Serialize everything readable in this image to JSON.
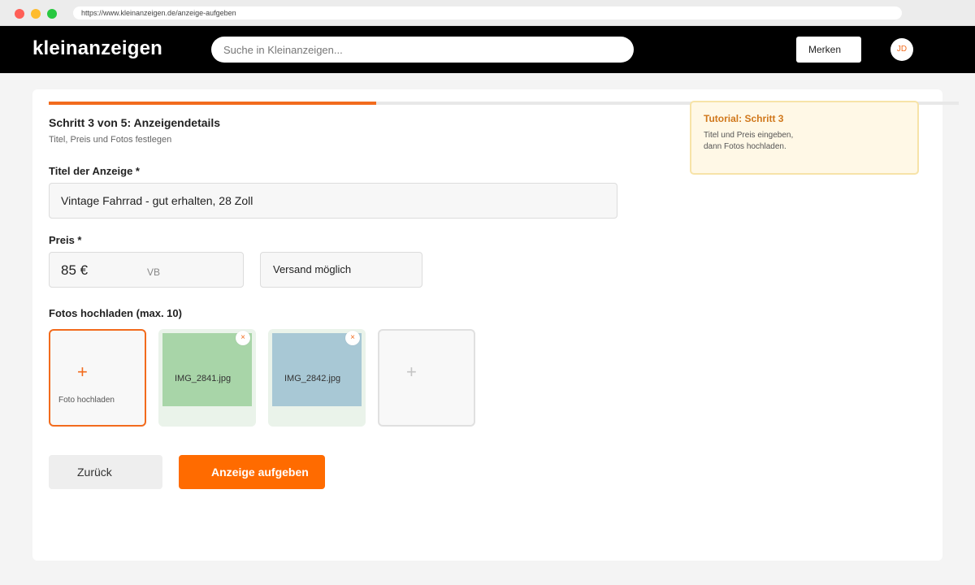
{
  "browser": {
    "url": "https://www.kleinanzeigen.de/anzeige-aufgeben"
  },
  "header": {
    "logo": "kleinanzeigen",
    "search_placeholder": "Suche in Kleinanzeigen...",
    "merken_label": "Merken",
    "avatar_initials": "JD"
  },
  "progress": {
    "step": 3,
    "total": 5
  },
  "step": {
    "title": "Schritt 3 von 5: Anzeigendetails",
    "subtitle": "Titel, Preis und Fotos festlegen"
  },
  "form": {
    "title_label": "Titel der Anzeige *",
    "title_value": "Vintage Fahrrad - gut erhalten, 28 Zoll",
    "price_label": "Preis *",
    "price_value": "85 €",
    "price_negotiable": "VB",
    "shipping_label": "Versand möglich",
    "photos_label": "Fotos hochladen (max. 10)",
    "upload_plus": "+",
    "upload_caption": "Foto hochladen",
    "photos": [
      {
        "filename": "IMG_2841.jpg",
        "remove": "×",
        "color": "#a8d5a8"
      },
      {
        "filename": "IMG_2842.jpg",
        "remove": "×",
        "color": "#a8c8d5"
      }
    ],
    "empty_slot_plus": "+"
  },
  "actions": {
    "back_label": "Zurück",
    "submit_label": "Anzeige aufgeben"
  },
  "tutorial": {
    "title": "Tutorial: Schritt 3",
    "line1": "Titel und Preis eingeben,",
    "line2": "dann Fotos hochladen."
  },
  "colors": {
    "accent": "#f26b1d",
    "header_bg": "#000000",
    "submit_bg": "#ff6b00"
  }
}
